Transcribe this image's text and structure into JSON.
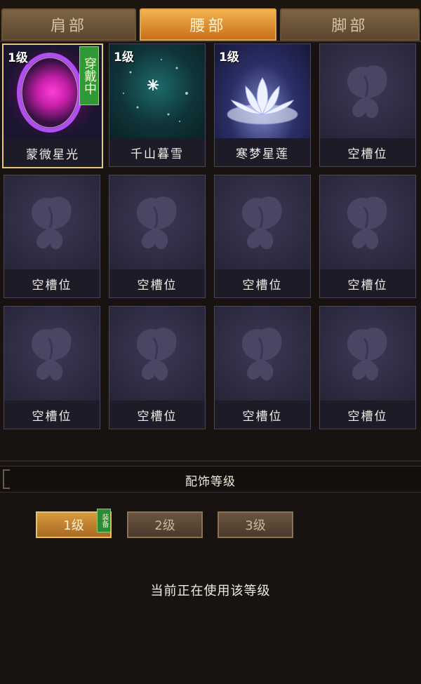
{
  "tabs": [
    {
      "label": "肩部",
      "active": false
    },
    {
      "label": "腰部",
      "active": true
    },
    {
      "label": "脚部",
      "active": false
    }
  ],
  "slots": [
    {
      "level": "1级",
      "name": "蒙微星光",
      "art": "purple-orb",
      "wearing": true,
      "wear_label": "穿戴中"
    },
    {
      "level": "1级",
      "name": "千山暮雪",
      "art": "snow-night",
      "wearing": false
    },
    {
      "level": "1级",
      "name": "寒梦星莲",
      "art": "lotus",
      "wearing": false
    },
    {
      "name": "空槽位",
      "art": "empty"
    },
    {
      "name": "空槽位",
      "art": "empty"
    },
    {
      "name": "空槽位",
      "art": "empty"
    },
    {
      "name": "空槽位",
      "art": "empty"
    },
    {
      "name": "空槽位",
      "art": "empty"
    },
    {
      "name": "空槽位",
      "art": "empty"
    },
    {
      "name": "空槽位",
      "art": "empty"
    },
    {
      "name": "空槽位",
      "art": "empty"
    },
    {
      "name": "空槽位",
      "art": "empty"
    }
  ],
  "level_section": {
    "title": "配饰等级",
    "buttons": [
      {
        "label": "1级",
        "active": true
      },
      {
        "label": "2级",
        "active": false
      },
      {
        "label": "3级",
        "active": false
      }
    ],
    "equip_badge": "装备",
    "status": "当前正在使用该等级"
  },
  "colors": {
    "accent": "#e3c77c",
    "wear_badge": "#2f9a35",
    "tab_active": "#e7a24a"
  }
}
